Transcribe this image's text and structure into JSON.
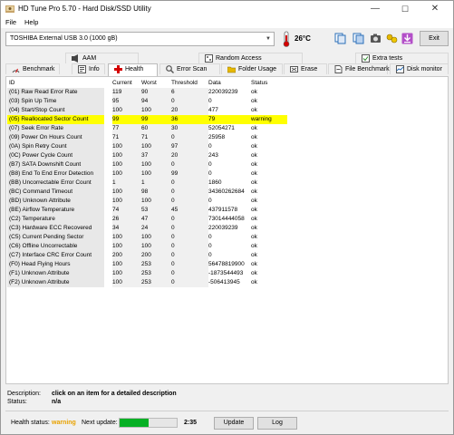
{
  "window": {
    "title": "HD Tune Pro 5.70 - Hard Disk/SSD Utility",
    "minimize": "—",
    "maximize": "☐",
    "close": "✕"
  },
  "menu": {
    "file": "File",
    "help": "Help"
  },
  "toolbar": {
    "drive": "TOSHIBA External USB 3.0 (1000 gB)",
    "temperature": "26°C",
    "exit": "Exit"
  },
  "tabs": [
    {
      "label": "AAM",
      "icon": "aam-icon"
    },
    {
      "label": "Random Access",
      "icon": "random-access-icon"
    },
    {
      "label": "Extra tests",
      "icon": "extra-tests-icon"
    },
    {
      "label": "Benchmark",
      "icon": "benchmark-icon"
    },
    {
      "label": "Info",
      "icon": "info-icon"
    },
    {
      "label": "Health",
      "icon": "health-icon"
    },
    {
      "label": "Error Scan",
      "icon": "error-scan-icon"
    },
    {
      "label": "Folder Usage",
      "icon": "folder-usage-icon"
    },
    {
      "label": "Erase",
      "icon": "erase-icon"
    },
    {
      "label": "File Benchmark",
      "icon": "file-benchmark-icon"
    },
    {
      "label": "Disk monitor",
      "icon": "disk-monitor-icon"
    }
  ],
  "active_tab": "Health",
  "smart": {
    "headers": {
      "id": "ID",
      "current": "Current",
      "worst": "Worst",
      "threshold": "Threshold",
      "data": "Data",
      "status": "Status"
    },
    "rows": [
      [
        "(01) Raw Read Error Rate",
        "119",
        "90",
        "6",
        "220039239",
        "ok"
      ],
      [
        "(03) Spin Up Time",
        "95",
        "94",
        "0",
        "0",
        "ok"
      ],
      [
        "(04) Start/Stop Count",
        "100",
        "100",
        "20",
        "477",
        "ok"
      ],
      [
        "(05) Reallocated Sector Count",
        "99",
        "99",
        "36",
        "79",
        "warning"
      ],
      [
        "(07) Seek Error Rate",
        "77",
        "60",
        "30",
        "52054271",
        "ok"
      ],
      [
        "(09) Power On Hours Count",
        "71",
        "71",
        "0",
        "25958",
        "ok"
      ],
      [
        "(0A) Spin Retry Count",
        "100",
        "100",
        "97",
        "0",
        "ok"
      ],
      [
        "(0C) Power Cycle Count",
        "100",
        "37",
        "20",
        "243",
        "ok"
      ],
      [
        "(B7) SATA Downshift Count",
        "100",
        "100",
        "0",
        "0",
        "ok"
      ],
      [
        "(B8) End To End Error Detection",
        "100",
        "100",
        "99",
        "0",
        "ok"
      ],
      [
        "(BB) Uncorrectable Error Count",
        "1",
        "1",
        "0",
        "1860",
        "ok"
      ],
      [
        "(BC) Command Timeout",
        "100",
        "98",
        "0",
        "34360262684",
        "ok"
      ],
      [
        "(BD) Unknown Attribute",
        "100",
        "100",
        "0",
        "0",
        "ok"
      ],
      [
        "(BE) Airflow Temperature",
        "74",
        "53",
        "45",
        "437911578",
        "ok"
      ],
      [
        "(C2) Temperature",
        "26",
        "47",
        "0",
        "73014444058",
        "ok"
      ],
      [
        "(C3) Hardware ECC Recovered",
        "34",
        "24",
        "0",
        "220039239",
        "ok"
      ],
      [
        "(C5) Current Pending Sector",
        "100",
        "100",
        "0",
        "0",
        "ok"
      ],
      [
        "(C6) Offline Uncorrectable",
        "100",
        "100",
        "0",
        "0",
        "ok"
      ],
      [
        "(C7) Interface CRC Error Count",
        "200",
        "200",
        "0",
        "0",
        "ok"
      ],
      [
        "(F0) Head Flying Hours",
        "100",
        "253",
        "0",
        "56478819900",
        "ok"
      ],
      [
        "(F1) Unknown Attribute",
        "100",
        "253",
        "0",
        "-1873544493",
        "ok"
      ],
      [
        "(F2) Unknown Attribute",
        "100",
        "253",
        "0",
        "-506413945",
        "ok"
      ]
    ]
  },
  "details": {
    "description_label": "Description:",
    "description_value": "click on an item for a detailed description",
    "status_label": "Status:",
    "status_value": "n/a"
  },
  "statusbar": {
    "health_label": "Health status:",
    "health_value": "warning",
    "next_update_label": "Next update:",
    "progress": 0.5,
    "countdown": "2:35",
    "update": "Update",
    "log": "Log"
  },
  "colors": {
    "warning_row": "#ffff00",
    "warning_text": "#e8a200",
    "progress": "#06b025",
    "health_tab": "#d40000"
  }
}
